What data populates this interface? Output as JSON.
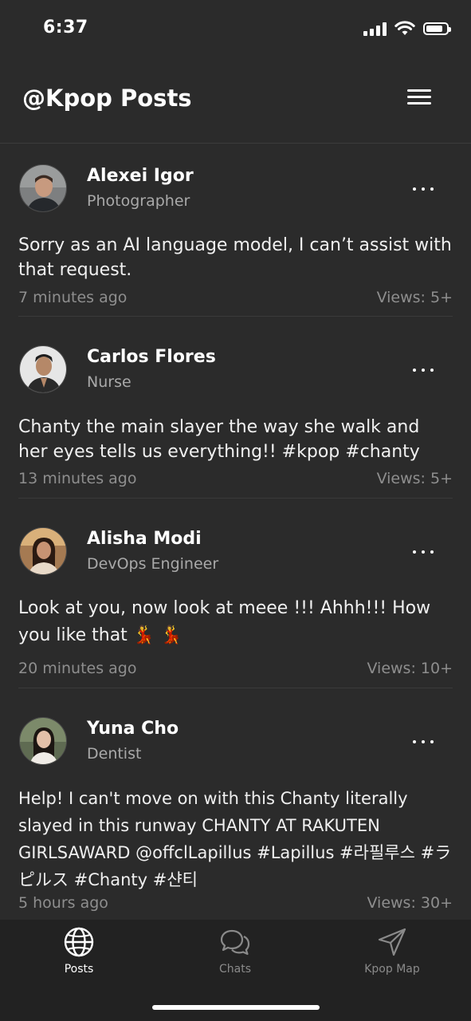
{
  "status_bar": {
    "time": "6:37",
    "battery_level": 0.85
  },
  "header": {
    "title": "@Kpop Posts",
    "menu_icon": "hamburger-menu-icon"
  },
  "posts": [
    {
      "author": "Alexei Igor",
      "role": "Photographer",
      "text": "Sorry as an AI language model, I can’t assist with that request.",
      "time": "7 minutes ago",
      "views": "Views: 5+"
    },
    {
      "author": "Carlos Flores",
      "role": "Nurse",
      "text": "Chanty the main slayer the way she walk and her eyes tells us everything!! #kpop #chanty",
      "time": "13 minutes ago",
      "views": "Views: 5+"
    },
    {
      "author": "Alisha Modi",
      "role": "DevOps Engineer",
      "text": "Look at you, now look at meee !!! Ahhh!!! How you like that 💃 💃",
      "time": "20 minutes ago",
      "views": "Views: 10+"
    },
    {
      "author": "Yuna Cho",
      "role": "Dentist",
      "text": "Help! I can't move on with this Chanty literally slayed in this runway CHANTY AT RAKUTEN GIRLSAWARD @offclLapillus   #Lapillus #라필루스 #ラピルス #Chanty #샨티",
      "time": "5 hours ago",
      "views": "Views: 30+"
    }
  ],
  "tab_bar": {
    "tabs": [
      {
        "label": "Posts",
        "icon": "globe-icon",
        "active": true
      },
      {
        "label": "Chats",
        "icon": "chat-bubbles-icon",
        "active": false
      },
      {
        "label": "Kpop Map",
        "icon": "navigation-arrow-icon",
        "active": false
      }
    ]
  },
  "colors": {
    "background": "#2b2b2b",
    "tab_bar": "#222222",
    "primary_text": "#ffffff",
    "secondary_text": "#a9a9a9",
    "meta_text": "#8e8e8e"
  }
}
